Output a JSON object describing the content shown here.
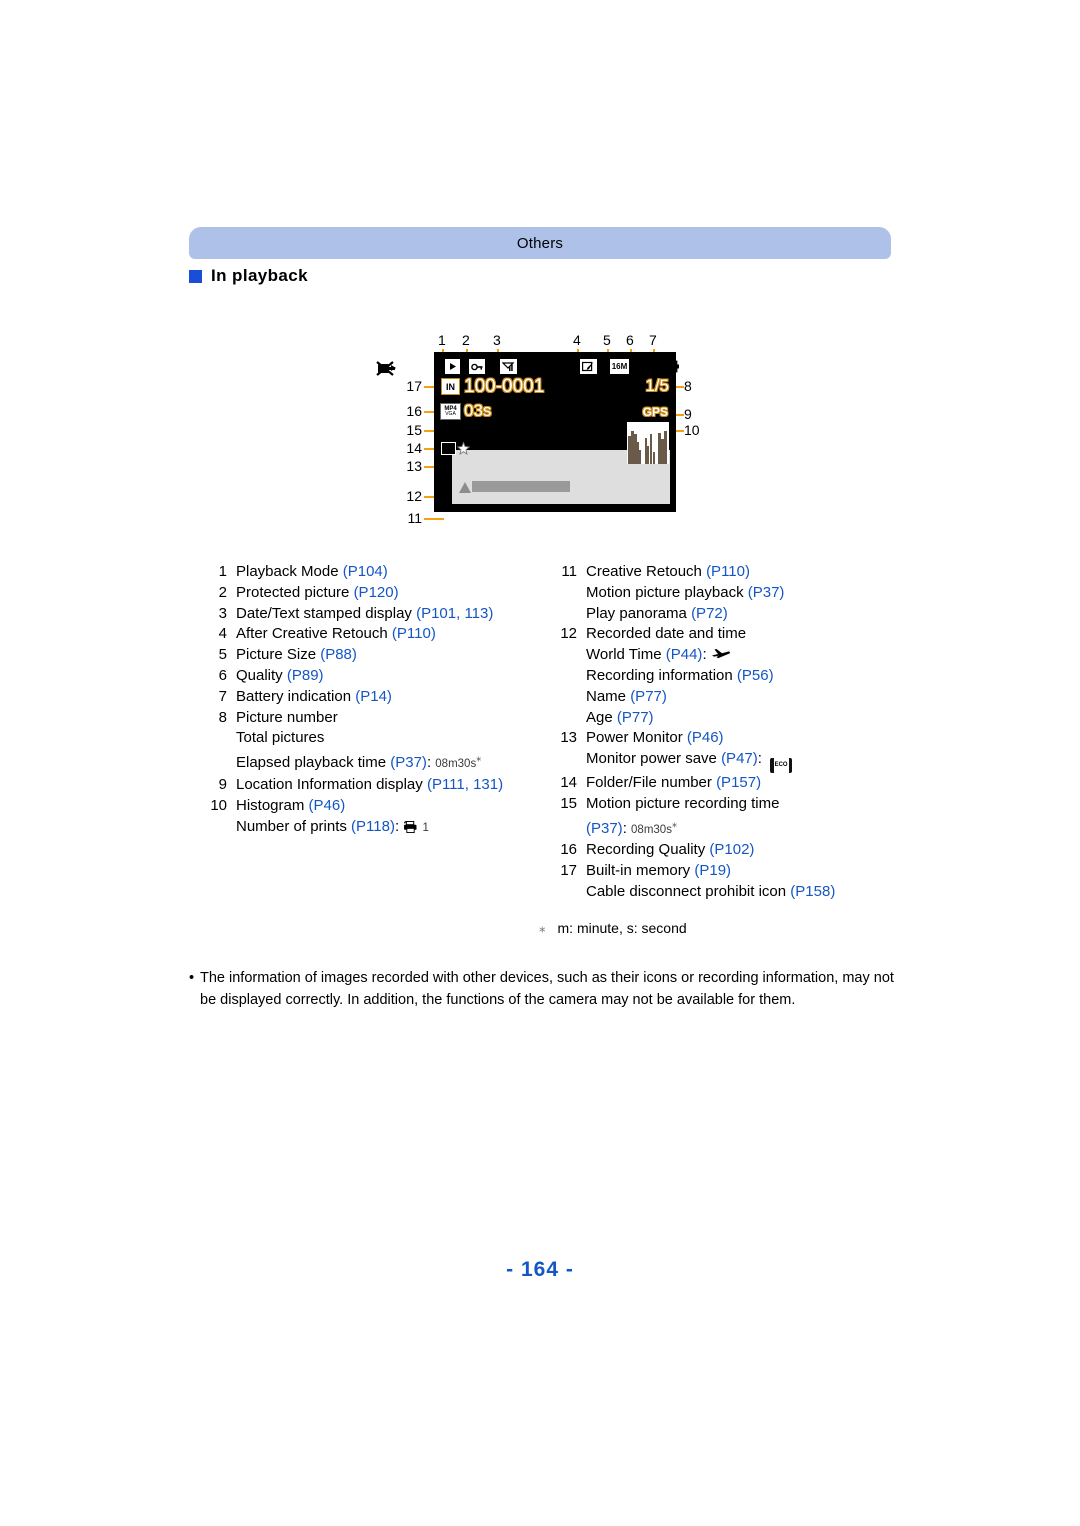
{
  "banner": {
    "title": "Others"
  },
  "section": {
    "label": "In playback"
  },
  "figure": {
    "top_numbers": [
      "1",
      "2",
      "3",
      "4",
      "5",
      "6",
      "7"
    ],
    "left_numbers": [
      "17",
      "16",
      "15",
      "14",
      "13",
      "12",
      "11"
    ],
    "right_numbers": [
      "8",
      "9",
      "10"
    ],
    "lcd": {
      "file_number": "100-0001",
      "elapsed_time": "03s",
      "picture_number": "1/5",
      "gps_label": "GPS",
      "picture_size": "16M",
      "recording_quality_top": "MP4",
      "recording_quality_bottom": "VGA",
      "memory_icon_label": "IN",
      "cable_prohibit_icon": "cable-disconnect-prohibit-icon"
    }
  },
  "legend_left": [
    {
      "n": "1",
      "text": "Playback Mode ",
      "ref": "(P104)"
    },
    {
      "n": "2",
      "text": "Protected picture ",
      "ref": "(P120)"
    },
    {
      "n": "3",
      "text": "Date/Text stamped display ",
      "ref": "(P101, 113)"
    },
    {
      "n": "4",
      "text": "After Creative Retouch ",
      "ref": "(P110)"
    },
    {
      "n": "5",
      "text": "Picture Size ",
      "ref": "(P88)"
    },
    {
      "n": "6",
      "text": "Quality ",
      "ref": "(P89)"
    },
    {
      "n": "7",
      "text": "Battery indication ",
      "ref": "(P14)"
    },
    {
      "n": "8",
      "text": "Picture number",
      "ref": ""
    },
    {
      "n": "",
      "text": "Total pictures",
      "ref": ""
    },
    {
      "n": "",
      "text": "Elapsed playback time ",
      "ref": "(P37)",
      "after": ":",
      "value": "08m30s",
      "star": true
    },
    {
      "n": "9",
      "text": "Location Information display ",
      "ref": "(P111, 131)"
    },
    {
      "n": "10",
      "text": "Histogram ",
      "ref": "(P46)"
    },
    {
      "n": "",
      "text": "Number of prints ",
      "ref": "(P118)",
      "after": ":",
      "icon": "printer-icon",
      "value": "1"
    }
  ],
  "legend_right": [
    {
      "n": "11",
      "text": "Creative Retouch ",
      "ref": "(P110)"
    },
    {
      "n": "",
      "text": "Motion picture playback ",
      "ref": "(P37)"
    },
    {
      "n": "",
      "text": "Play panorama ",
      "ref": "(P72)"
    },
    {
      "n": "12",
      "text": "Recorded date and time",
      "ref": ""
    },
    {
      "n": "",
      "text": "World Time ",
      "ref": "(P44)",
      "after": ":",
      "icon": "airplane-icon"
    },
    {
      "n": "",
      "text": "Recording information ",
      "ref": "(P56)"
    },
    {
      "n": "",
      "text": "Name ",
      "ref": "(P77)"
    },
    {
      "n": "",
      "text": "Age ",
      "ref": "(P77)"
    },
    {
      "n": "13",
      "text": "Power Monitor ",
      "ref": "(P46)"
    },
    {
      "n": "",
      "text": "Monitor power save ",
      "ref": "(P47)",
      "after": ":",
      "icon": "eco-icon"
    },
    {
      "n": "14",
      "text": "Folder/File number ",
      "ref": "(P157)"
    },
    {
      "n": "15",
      "text": "Motion picture recording time",
      "ref": ""
    },
    {
      "n": "",
      "text": "",
      "ref": "(P37)",
      "after": ":",
      "value": "08m30s",
      "star": true
    },
    {
      "n": "16",
      "text": "Recording Quality ",
      "ref": "(P102)"
    },
    {
      "n": "17",
      "text": "Built-in memory ",
      "ref": "(P19)"
    },
    {
      "n": "",
      "text": "Cable disconnect prohibit icon ",
      "ref": "(P158)"
    }
  ],
  "footnote": {
    "mark": "⁎",
    "text": "m: minute, s: second"
  },
  "note": {
    "bullet": "•",
    "text": "The information of images recorded with other devices, such as their icons or recording information, may not be displayed correctly. In addition, the functions of the camera may not be available for them."
  },
  "page_number": "- 164 -",
  "colors": {
    "banner": "#aec1e8",
    "accent": "#1456c4",
    "square": "#1b4ed8",
    "leader": "#f4a013"
  }
}
